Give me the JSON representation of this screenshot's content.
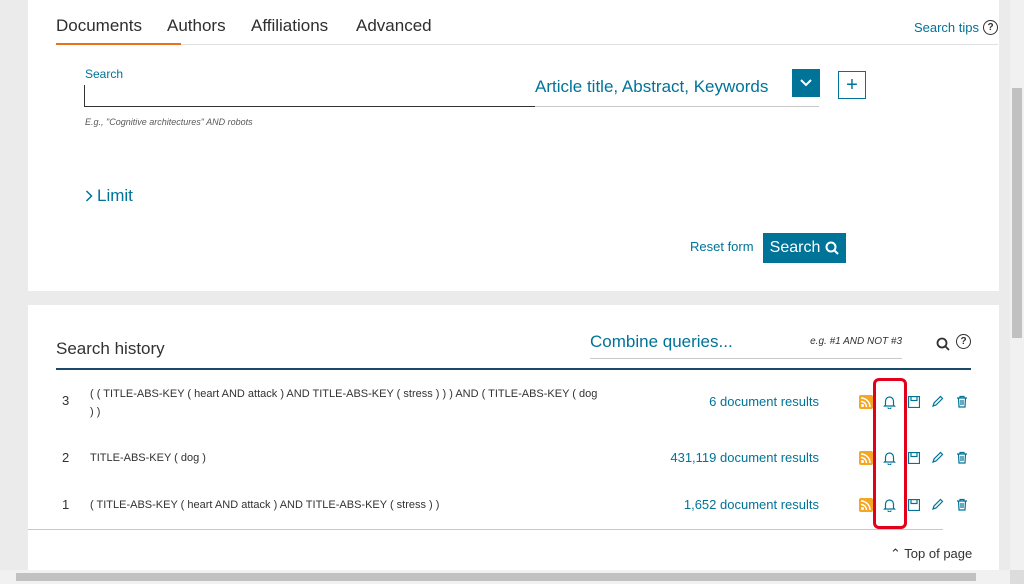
{
  "tabs": [
    {
      "label": "Documents"
    },
    {
      "label": "Authors"
    },
    {
      "label": "Affiliations"
    },
    {
      "label": "Advanced"
    }
  ],
  "active_tab": "Documents",
  "search_tips": "Search tips",
  "search": {
    "label": "Search",
    "value": "",
    "hint": "E.g., \"Cognitive architectures\" AND robots",
    "field": "Article title, Abstract, Keywords"
  },
  "limit_label": "Limit",
  "reset_label": "Reset form",
  "search_button": "Search",
  "history": {
    "title": "Search history",
    "combine_placeholder": "Combine queries...",
    "combine_hint": "e.g. #1 AND NOT #3",
    "rows": [
      {
        "num": "3",
        "query": "( ( TITLE-ABS-KEY ( heart  AND attack )  AND  TITLE-ABS-KEY ( stress ) ) )  AND  ( TITLE-ABS-KEY ( dog ) )",
        "results": "6 document results"
      },
      {
        "num": "2",
        "query": "TITLE-ABS-KEY ( dog )",
        "results": "431,119 document results"
      },
      {
        "num": "1",
        "query": "( TITLE-ABS-KEY ( heart  AND attack )  AND  TITLE-ABS-KEY ( stress ) )",
        "results": "1,652 document results"
      }
    ]
  },
  "top_of_page": "Top of page",
  "colors": {
    "accent": "#007398",
    "tab_underline": "#e9711c",
    "highlight": "#e2001a",
    "rss": "#f5a623"
  }
}
